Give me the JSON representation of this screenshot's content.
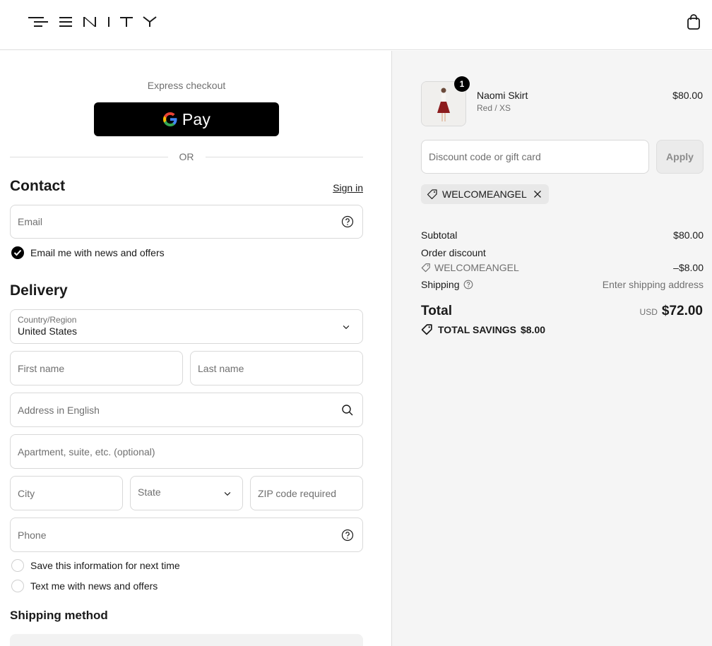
{
  "header": {
    "brand": "FENITY"
  },
  "express": {
    "label": "Express checkout",
    "gpay_label": "Pay",
    "or_label": "OR"
  },
  "contact": {
    "heading": "Contact",
    "sign_in": "Sign in",
    "email_placeholder": "Email",
    "news_checkbox_label": "Email me with news and offers",
    "news_checked": true
  },
  "delivery": {
    "heading": "Delivery",
    "country_label": "Country/Region",
    "country_value": "United States",
    "first_name_placeholder": "First name",
    "last_name_placeholder": "Last name",
    "address_placeholder": "Address in English",
    "apartment_placeholder": "Apartment, suite, etc. (optional)",
    "city_placeholder": "City",
    "state_placeholder": "State",
    "zip_placeholder": "ZIP code required",
    "phone_placeholder": "Phone",
    "save_info_label": "Save this information for next time",
    "text_me_label": "Text me with news and offers"
  },
  "shipping_method": {
    "heading": "Shipping method"
  },
  "order": {
    "item": {
      "name": "Naomi Skirt",
      "variant": "Red / XS",
      "price": "$80.00",
      "quantity": "1"
    },
    "discount_placeholder": "Discount code or gift card",
    "apply_label": "Apply",
    "applied_code": "WELCOMEANGEL",
    "subtotal_label": "Subtotal",
    "subtotal_value": "$80.00",
    "order_discount_label": "Order discount",
    "discount_code": "WELCOMEANGEL",
    "discount_value": "–$8.00",
    "shipping_label": "Shipping",
    "shipping_value": "Enter shipping address",
    "total_label": "Total",
    "total_currency": "USD",
    "total_value": "$72.00",
    "savings_label": "TOTAL SAVINGS",
    "savings_value": "$8.00"
  },
  "colors": {
    "primary": "#000000",
    "muted": "#707070",
    "border": "#d9d9d9",
    "summary_bg": "#f5f5f5"
  }
}
